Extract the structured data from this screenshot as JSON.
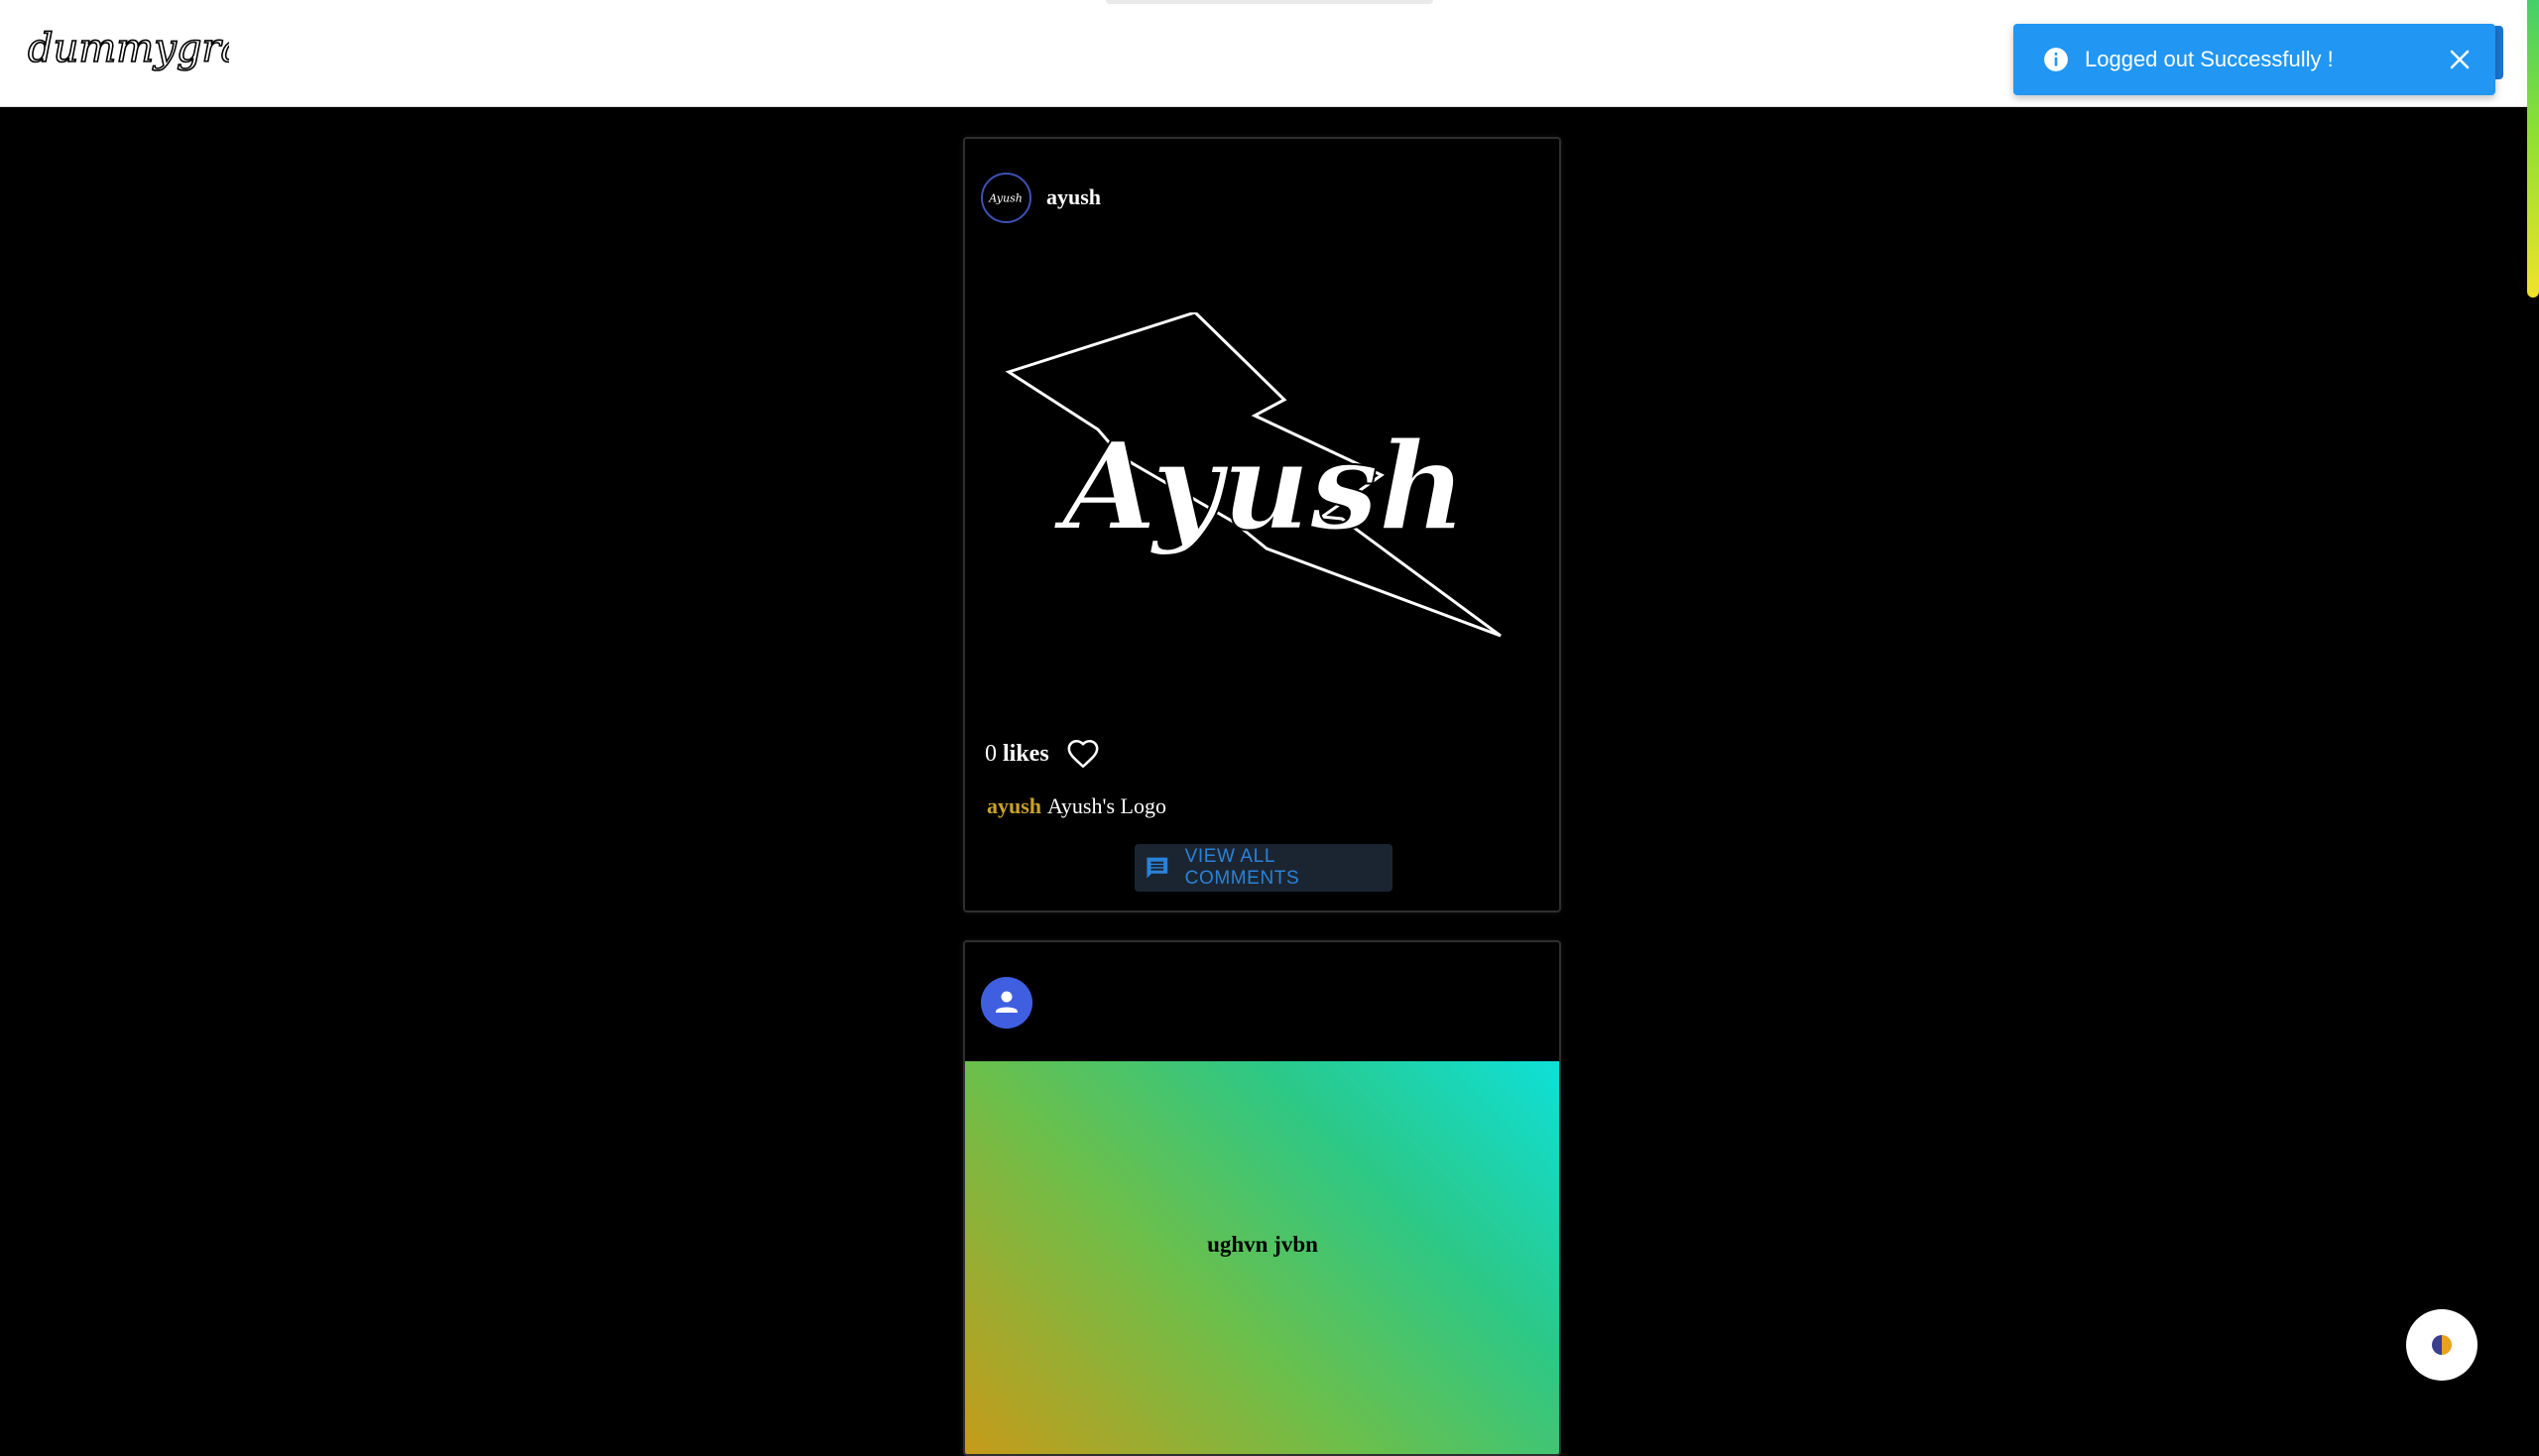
{
  "header": {
    "brand": "dummygram"
  },
  "toast": {
    "message": "Logged out Successfully !",
    "type": "info",
    "color": "#2196f3"
  },
  "posts": [
    {
      "username": "ayush",
      "image_text": "Ayush",
      "avatar_text": "Ayush",
      "likes_count": "0",
      "likes_word": "likes",
      "caption_user": "ayush",
      "caption_text": "Ayush's Logo",
      "view_comments_label": "VIEW ALL COMMENTS"
    },
    {
      "username": "",
      "image_text": "ughvn jvbn"
    }
  ],
  "colors": {
    "background": "#000000",
    "header_bg": "#ffffff",
    "accent_blue": "#2196f3",
    "caption_user": "#c9a227",
    "avatar_default": "#3f5fe0"
  },
  "icons": {
    "toast": "info-icon",
    "close": "close-icon",
    "like": "heart-outline-icon",
    "comments": "comment-icon",
    "avatar_default": "person-icon",
    "theme": "half-circle-icon"
  }
}
